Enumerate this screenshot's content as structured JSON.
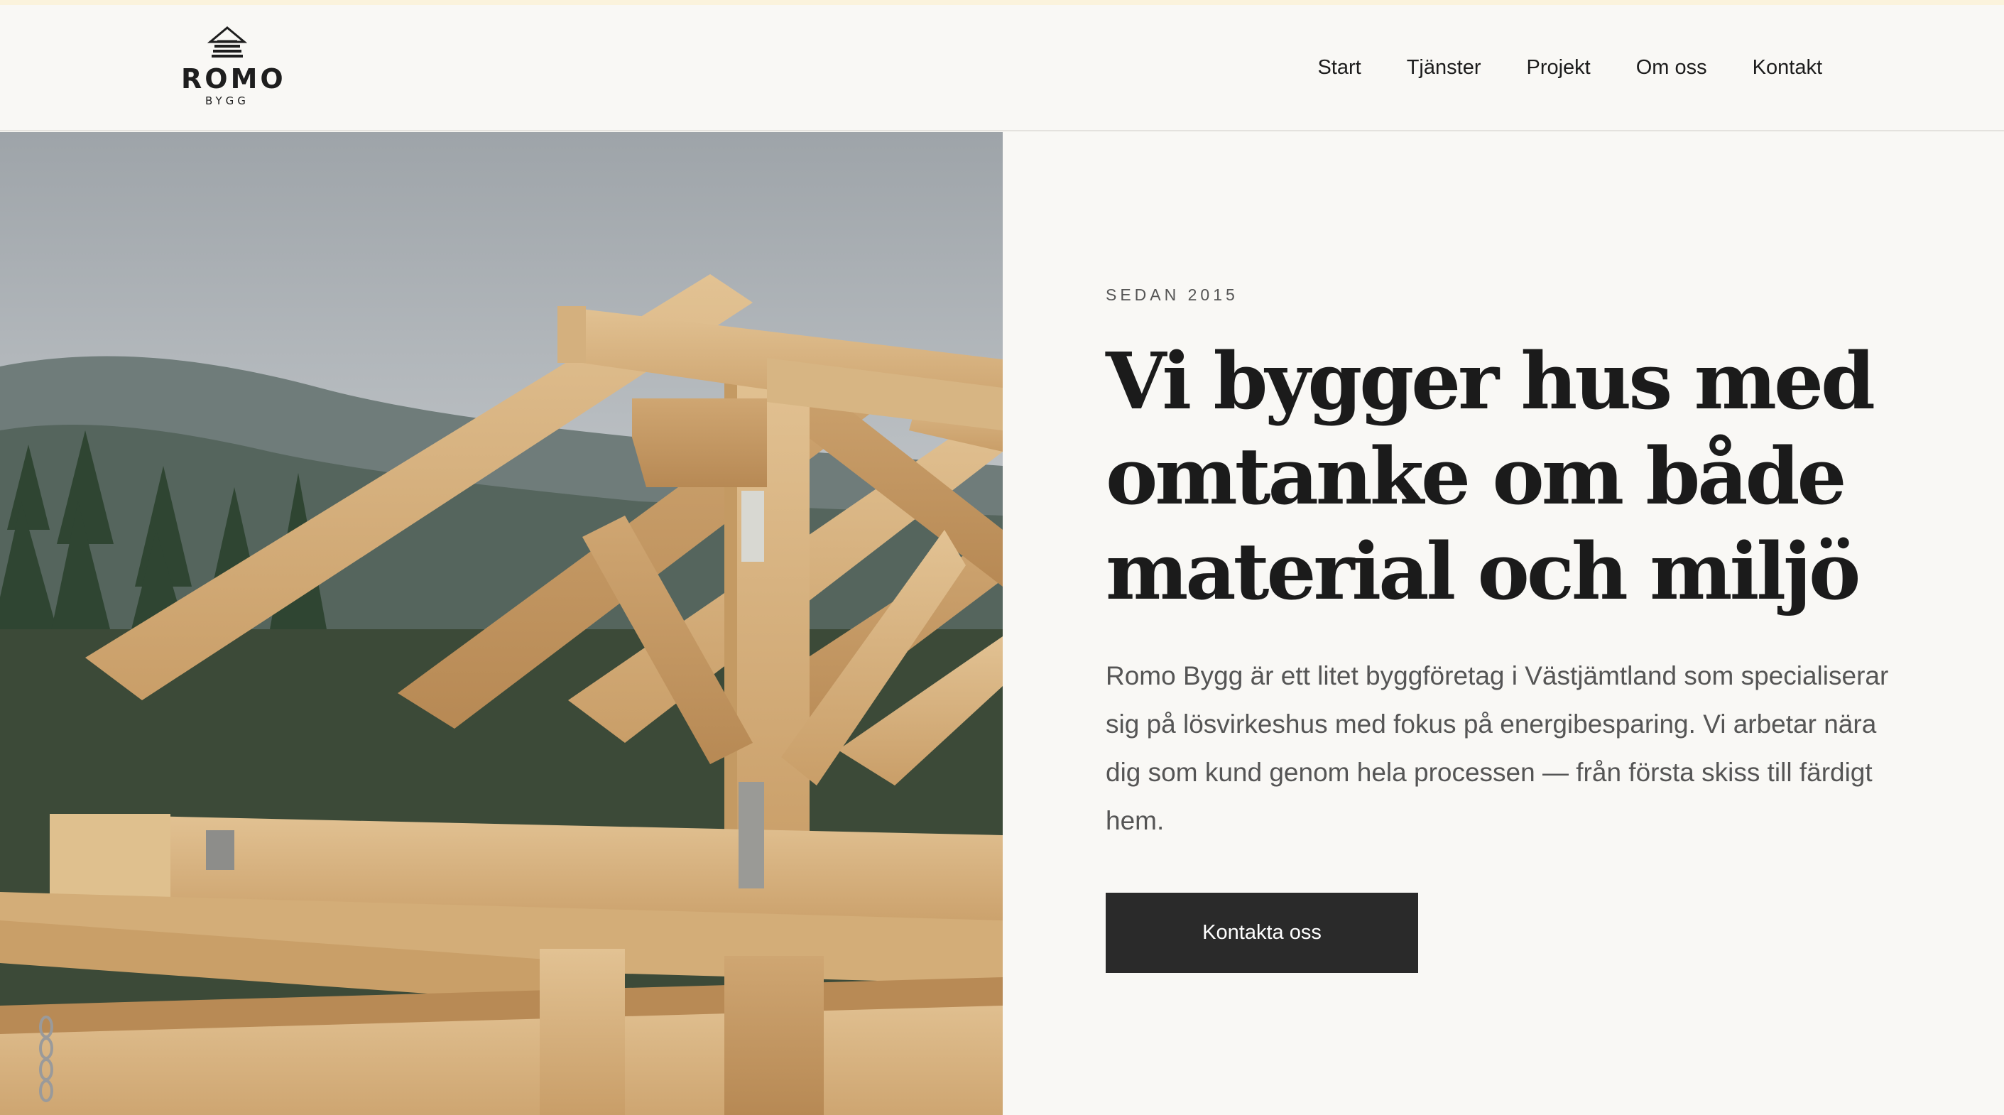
{
  "brand": {
    "name": "ROMO",
    "sub": "BYGG"
  },
  "nav": [
    {
      "label": "Start"
    },
    {
      "label": "Tjänster"
    },
    {
      "label": "Projekt"
    },
    {
      "label": "Om oss"
    },
    {
      "label": "Kontakt"
    }
  ],
  "hero": {
    "eyebrow": "SEDAN 2015",
    "title": "Vi bygger hus med omtanke om både material och miljö",
    "body": "Romo Bygg är ett litet byggföretag i Västjämtland som specialiserar sig på lösvirkeshus med fokus på energibesparing. Vi arbetar nära dig som kund genom hela processen — från första skiss till färdigt hem.",
    "cta_label": "Kontakta oss",
    "image_icon": "timber-roof-frame-photo"
  },
  "colors": {
    "background": "#f9f8f5",
    "text": "#1c1c1c",
    "muted": "#555555",
    "button": "#2a2a2a",
    "top_accent": "#fbf3dc"
  }
}
